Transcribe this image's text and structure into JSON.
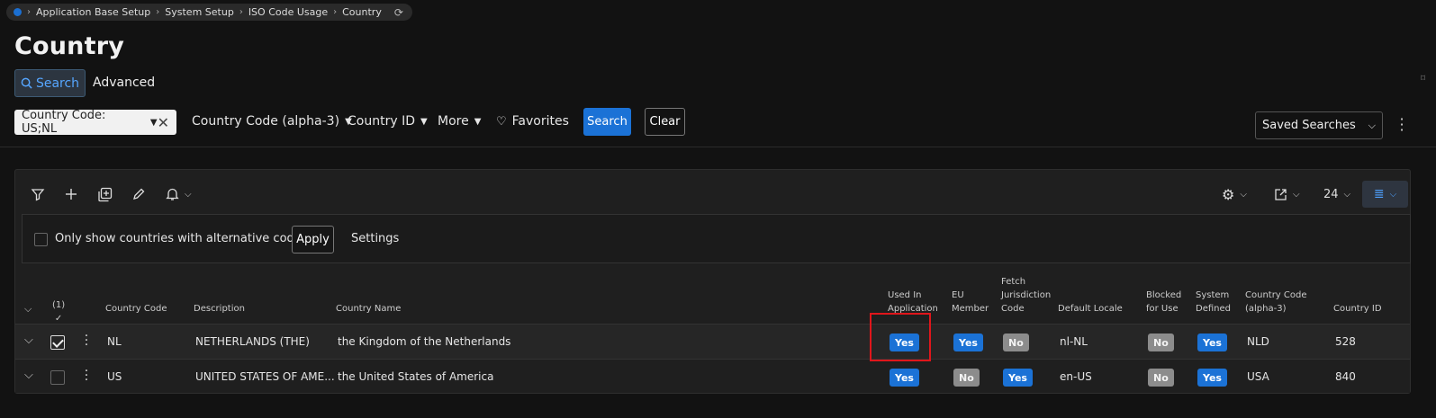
{
  "breadcrumb": [
    "Application Base Setup",
    "System Setup",
    "ISO Code Usage",
    "Country"
  ],
  "page_title": "Country",
  "search_tabs": {
    "search": "Search",
    "advanced": "Advanced"
  },
  "filters": {
    "active_chip": "Country Code: US;NL",
    "dropdowns": [
      "Country Code (alpha-3)",
      "Country ID",
      "More"
    ],
    "favorites": "Favorites",
    "search_button": "Search",
    "clear_button": "Clear",
    "saved_searches": "Saved Searches"
  },
  "toolbar": {
    "page_size": "24"
  },
  "options": {
    "checkbox_label": "Only show countries with alternative codes",
    "apply_button": "Apply",
    "settings_link": "Settings"
  },
  "table": {
    "selected_count": "(1)",
    "headers": {
      "country_code": "Country Code",
      "description": "Description",
      "country_name": "Country Name",
      "used_in_application": [
        "Used In",
        "Application"
      ],
      "eu_member": [
        "EU",
        "Member"
      ],
      "fetch_jurisdiction": [
        "Fetch",
        "Jurisdiction",
        "Code"
      ],
      "default_locale": "Default Locale",
      "blocked_for_use": [
        "Blocked",
        "for Use"
      ],
      "system_defined": [
        "System",
        "Defined"
      ],
      "country_code_alpha3": [
        "Country Code",
        "(alpha-3)"
      ],
      "country_id": "Country ID"
    },
    "rows": [
      {
        "code": "NL",
        "description": "NETHERLANDS (THE)",
        "name": "the Kingdom of the Netherlands",
        "used": "Yes",
        "eu": "Yes",
        "fetch": "No",
        "locale": "nl-NL",
        "blocked": "No",
        "system": "Yes",
        "alpha3": "NLD",
        "id": "528",
        "selected": true
      },
      {
        "code": "US",
        "description": "UNITED STATES OF AME...",
        "name": "the United States of America",
        "used": "Yes",
        "eu": "No",
        "fetch": "Yes",
        "locale": "en-US",
        "blocked": "No",
        "system": "Yes",
        "alpha3": "USA",
        "id": "840",
        "selected": false
      }
    ]
  },
  "colors": {
    "accent": "#1b72d6",
    "badge_no": "#8c8c8c",
    "highlight": "#e0161b"
  }
}
